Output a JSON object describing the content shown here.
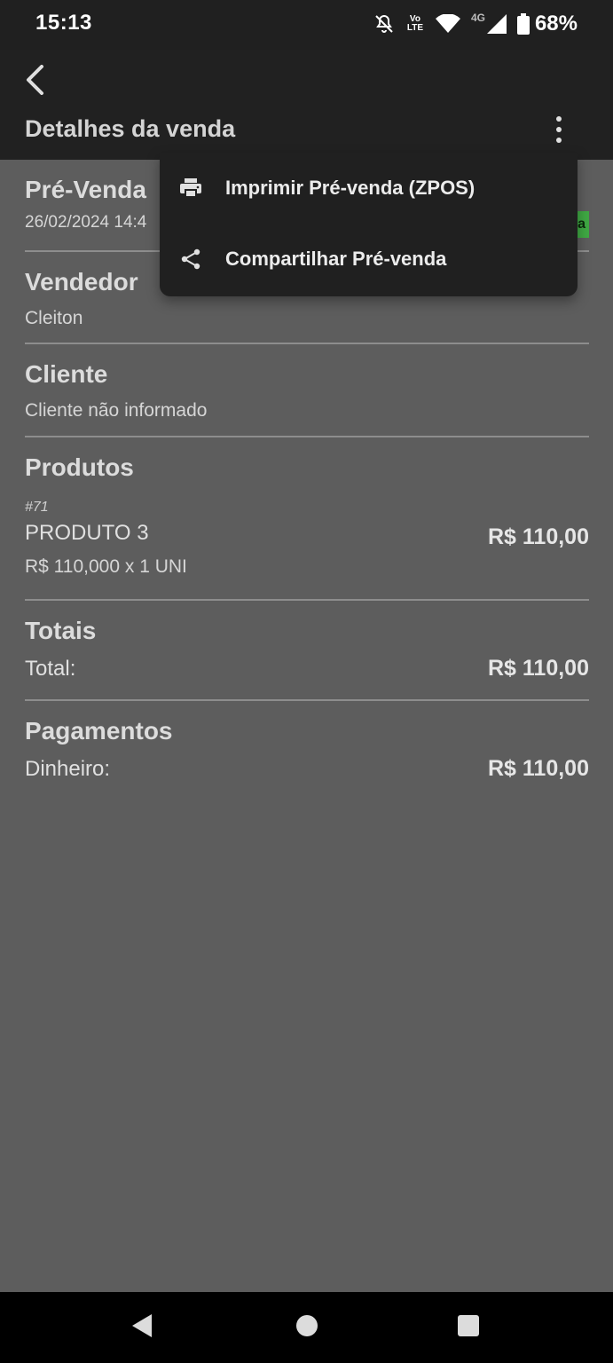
{
  "status_bar": {
    "time": "15:13",
    "lte_top": "Vo",
    "lte_bottom": "LTE",
    "network": "4G",
    "battery": "68%",
    "icons": [
      "bell-off-icon",
      "volte-icon",
      "wifi-icon",
      "signal-icon",
      "battery-icon"
    ]
  },
  "app_bar": {
    "back_icon": "chevron-left-icon",
    "title": "Detalhes da venda",
    "overflow_icon": "more-vertical-icon"
  },
  "sections": {
    "prevenda": {
      "title": "Pré-Venda",
      "datetime": "26/02/2024 14:4",
      "status_badge": "a",
      "badge_color": "#3fa843"
    },
    "vendedor": {
      "title": "Vendedor",
      "value": "Cleiton"
    },
    "cliente": {
      "title": "Cliente",
      "value": "Cliente não informado"
    },
    "produtos": {
      "title": "Produtos",
      "items": [
        {
          "code": "#71",
          "name": "PRODUTO 3",
          "total": "R$ 110,00",
          "detail": "R$ 110,000 x 1 UNI"
        }
      ]
    },
    "totais": {
      "title": "Totais",
      "label": "Total:",
      "value": "R$ 110,00"
    },
    "pagamentos": {
      "title": "Pagamentos",
      "label": "Dinheiro:",
      "value": "R$ 110,00"
    }
  },
  "menu": {
    "items": [
      {
        "icon": "printer-icon",
        "label": "Imprimir Pré-venda (ZPOS)"
      },
      {
        "icon": "share-icon",
        "label": "Compartilhar Pré-venda"
      }
    ]
  },
  "nav_bar": {
    "icons": [
      "back-triangle-icon",
      "home-circle-icon",
      "recents-square-icon"
    ]
  },
  "colors": {
    "background": "#5d5d5d",
    "app_bar": "#212121",
    "menu": "#202020",
    "accent_green": "#3fa843"
  }
}
